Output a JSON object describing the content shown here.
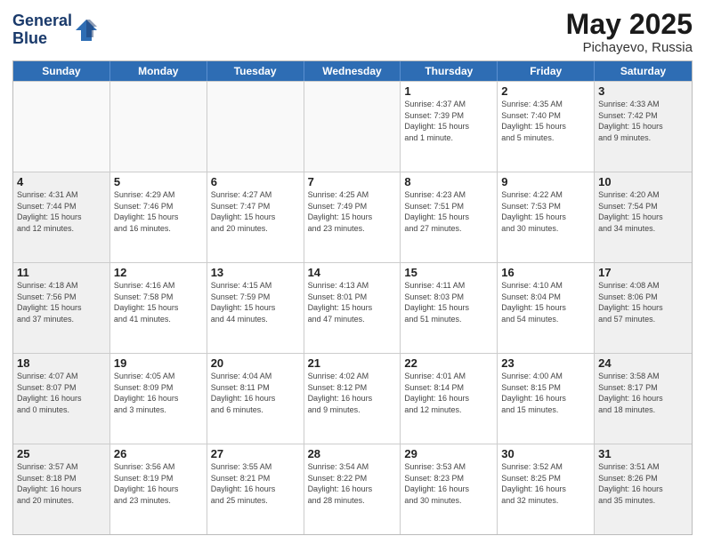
{
  "header": {
    "logo_line1": "General",
    "logo_line2": "Blue",
    "title": "May 2025",
    "location": "Pichayevo, Russia"
  },
  "weekdays": [
    "Sunday",
    "Monday",
    "Tuesday",
    "Wednesday",
    "Thursday",
    "Friday",
    "Saturday"
  ],
  "rows": [
    [
      {
        "day": "",
        "info": "",
        "empty": true
      },
      {
        "day": "",
        "info": "",
        "empty": true
      },
      {
        "day": "",
        "info": "",
        "empty": true
      },
      {
        "day": "",
        "info": "",
        "empty": true
      },
      {
        "day": "1",
        "info": "Sunrise: 4:37 AM\nSunset: 7:39 PM\nDaylight: 15 hours\nand 1 minute."
      },
      {
        "day": "2",
        "info": "Sunrise: 4:35 AM\nSunset: 7:40 PM\nDaylight: 15 hours\nand 5 minutes."
      },
      {
        "day": "3",
        "info": "Sunrise: 4:33 AM\nSunset: 7:42 PM\nDaylight: 15 hours\nand 9 minutes."
      }
    ],
    [
      {
        "day": "4",
        "info": "Sunrise: 4:31 AM\nSunset: 7:44 PM\nDaylight: 15 hours\nand 12 minutes."
      },
      {
        "day": "5",
        "info": "Sunrise: 4:29 AM\nSunset: 7:46 PM\nDaylight: 15 hours\nand 16 minutes."
      },
      {
        "day": "6",
        "info": "Sunrise: 4:27 AM\nSunset: 7:47 PM\nDaylight: 15 hours\nand 20 minutes."
      },
      {
        "day": "7",
        "info": "Sunrise: 4:25 AM\nSunset: 7:49 PM\nDaylight: 15 hours\nand 23 minutes."
      },
      {
        "day": "8",
        "info": "Sunrise: 4:23 AM\nSunset: 7:51 PM\nDaylight: 15 hours\nand 27 minutes."
      },
      {
        "day": "9",
        "info": "Sunrise: 4:22 AM\nSunset: 7:53 PM\nDaylight: 15 hours\nand 30 minutes."
      },
      {
        "day": "10",
        "info": "Sunrise: 4:20 AM\nSunset: 7:54 PM\nDaylight: 15 hours\nand 34 minutes."
      }
    ],
    [
      {
        "day": "11",
        "info": "Sunrise: 4:18 AM\nSunset: 7:56 PM\nDaylight: 15 hours\nand 37 minutes."
      },
      {
        "day": "12",
        "info": "Sunrise: 4:16 AM\nSunset: 7:58 PM\nDaylight: 15 hours\nand 41 minutes."
      },
      {
        "day": "13",
        "info": "Sunrise: 4:15 AM\nSunset: 7:59 PM\nDaylight: 15 hours\nand 44 minutes."
      },
      {
        "day": "14",
        "info": "Sunrise: 4:13 AM\nSunset: 8:01 PM\nDaylight: 15 hours\nand 47 minutes."
      },
      {
        "day": "15",
        "info": "Sunrise: 4:11 AM\nSunset: 8:03 PM\nDaylight: 15 hours\nand 51 minutes."
      },
      {
        "day": "16",
        "info": "Sunrise: 4:10 AM\nSunset: 8:04 PM\nDaylight: 15 hours\nand 54 minutes."
      },
      {
        "day": "17",
        "info": "Sunrise: 4:08 AM\nSunset: 8:06 PM\nDaylight: 15 hours\nand 57 minutes."
      }
    ],
    [
      {
        "day": "18",
        "info": "Sunrise: 4:07 AM\nSunset: 8:07 PM\nDaylight: 16 hours\nand 0 minutes."
      },
      {
        "day": "19",
        "info": "Sunrise: 4:05 AM\nSunset: 8:09 PM\nDaylight: 16 hours\nand 3 minutes."
      },
      {
        "day": "20",
        "info": "Sunrise: 4:04 AM\nSunset: 8:11 PM\nDaylight: 16 hours\nand 6 minutes."
      },
      {
        "day": "21",
        "info": "Sunrise: 4:02 AM\nSunset: 8:12 PM\nDaylight: 16 hours\nand 9 minutes."
      },
      {
        "day": "22",
        "info": "Sunrise: 4:01 AM\nSunset: 8:14 PM\nDaylight: 16 hours\nand 12 minutes."
      },
      {
        "day": "23",
        "info": "Sunrise: 4:00 AM\nSunset: 8:15 PM\nDaylight: 16 hours\nand 15 minutes."
      },
      {
        "day": "24",
        "info": "Sunrise: 3:58 AM\nSunset: 8:17 PM\nDaylight: 16 hours\nand 18 minutes."
      }
    ],
    [
      {
        "day": "25",
        "info": "Sunrise: 3:57 AM\nSunset: 8:18 PM\nDaylight: 16 hours\nand 20 minutes."
      },
      {
        "day": "26",
        "info": "Sunrise: 3:56 AM\nSunset: 8:19 PM\nDaylight: 16 hours\nand 23 minutes."
      },
      {
        "day": "27",
        "info": "Sunrise: 3:55 AM\nSunset: 8:21 PM\nDaylight: 16 hours\nand 25 minutes."
      },
      {
        "day": "28",
        "info": "Sunrise: 3:54 AM\nSunset: 8:22 PM\nDaylight: 16 hours\nand 28 minutes."
      },
      {
        "day": "29",
        "info": "Sunrise: 3:53 AM\nSunset: 8:23 PM\nDaylight: 16 hours\nand 30 minutes."
      },
      {
        "day": "30",
        "info": "Sunrise: 3:52 AM\nSunset: 8:25 PM\nDaylight: 16 hours\nand 32 minutes."
      },
      {
        "day": "31",
        "info": "Sunrise: 3:51 AM\nSunset: 8:26 PM\nDaylight: 16 hours\nand 35 minutes."
      }
    ]
  ]
}
